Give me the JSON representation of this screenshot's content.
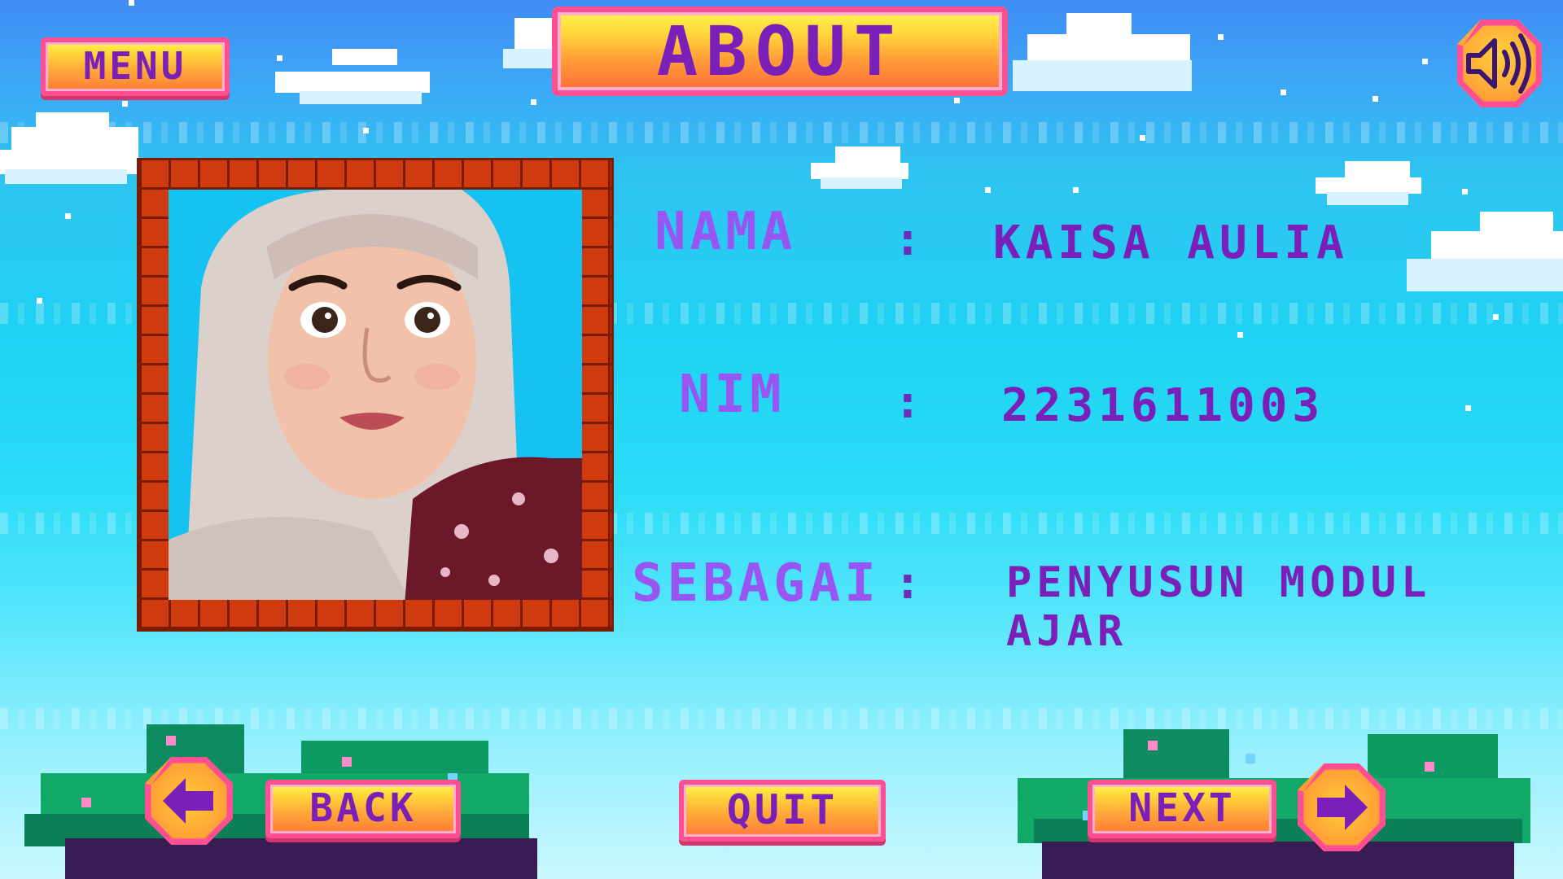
{
  "title": "ABOUT",
  "menu_label": "MENU",
  "profile": {
    "rows": [
      {
        "label": "NAMA",
        "colon": ":",
        "value": "KAISA AULIA"
      },
      {
        "label": "NIM",
        "colon": ":",
        "value": "2231611003"
      },
      {
        "label": "SEBAGAI",
        "colon": ":",
        "value": "PENYUSUN MODUL AJAR"
      }
    ]
  },
  "nav": {
    "back_label": "BACK",
    "quit_label": "QUIT",
    "next_label": "NEXT"
  },
  "icons": {
    "sound": "speaker-volume-icon",
    "back_arrow": "arrow-left-icon",
    "next_arrow": "arrow-right-icon"
  },
  "colors": {
    "button_fill": "#ffb13a",
    "button_border": "#ff4f93",
    "text_purple": "#7a1fb8",
    "label_violet": "#9955f2",
    "brick": "#cf3a0f"
  }
}
